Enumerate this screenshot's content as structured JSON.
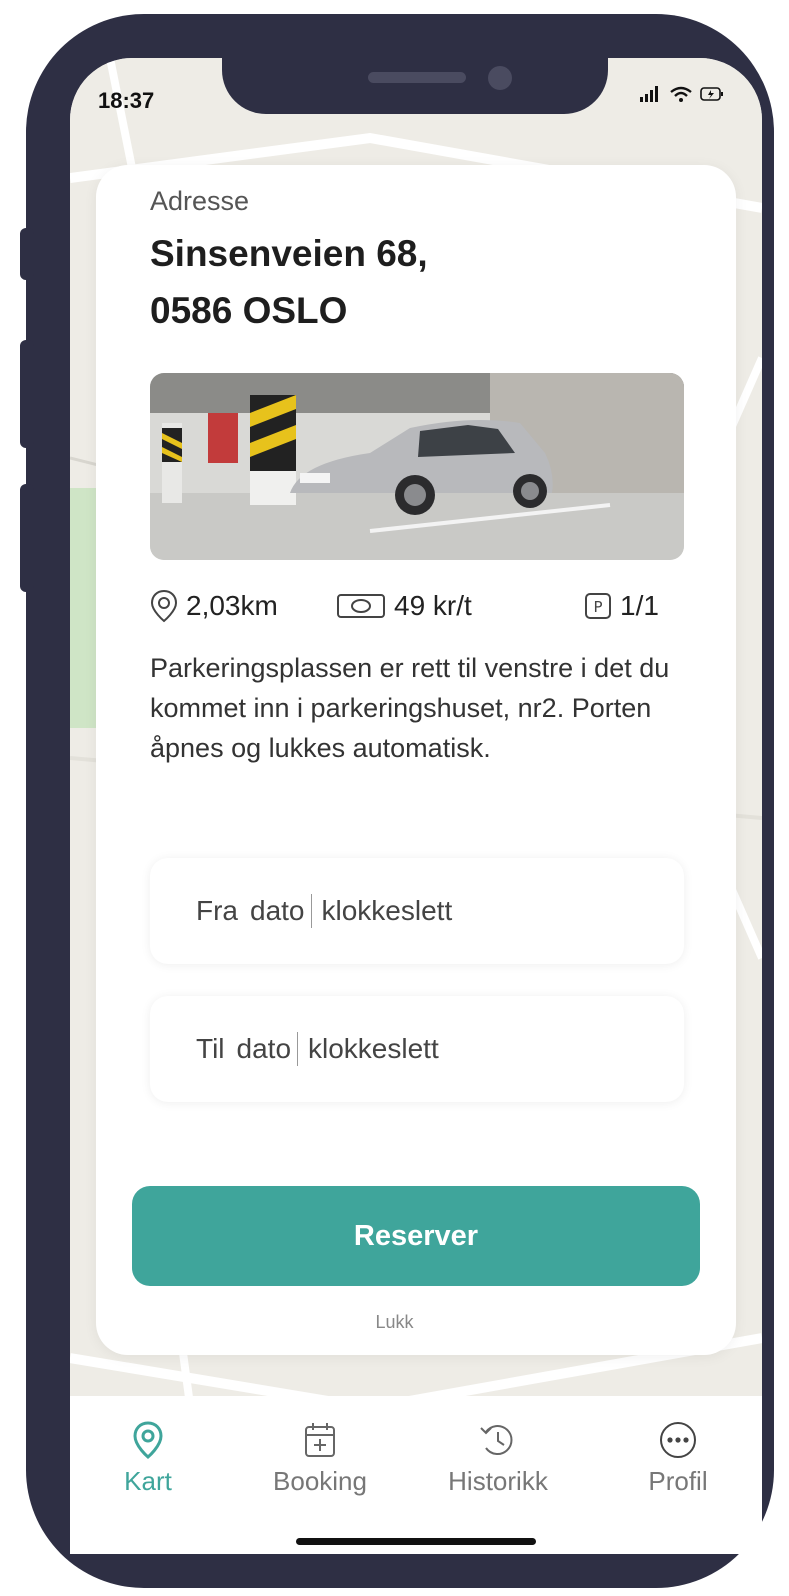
{
  "status_bar": {
    "time": "18:37"
  },
  "listing": {
    "address_label": "Adresse",
    "address_line1": "Sinsenveien 68,",
    "address_line2": "0586 OSLO",
    "distance": "2,03km",
    "price": "49 kr/t",
    "spots": "1/1",
    "description": "Parkeringsplassen er rett til venstre i det du kommet inn i parkeringshuset, nr2. Porten åpnes og lukkes automatisk."
  },
  "form": {
    "from_prefix": "Fra",
    "from_date": "dato",
    "from_time": "klokkeslett",
    "to_prefix": "Til",
    "to_date": "dato",
    "to_time": "klokkeslett"
  },
  "actions": {
    "reserve_label": "Reserver",
    "close_label": "Lukk"
  },
  "tabs": [
    {
      "label": "Kart",
      "icon": "map-pin-icon",
      "active": true
    },
    {
      "label": "Booking",
      "icon": "calendar-add-icon",
      "active": false
    },
    {
      "label": "Historikk",
      "icon": "history-icon",
      "active": false
    },
    {
      "label": "Profil",
      "icon": "more-icon",
      "active": false
    }
  ],
  "colors": {
    "accent": "#3fa59b",
    "frame": "#2e2f44"
  }
}
